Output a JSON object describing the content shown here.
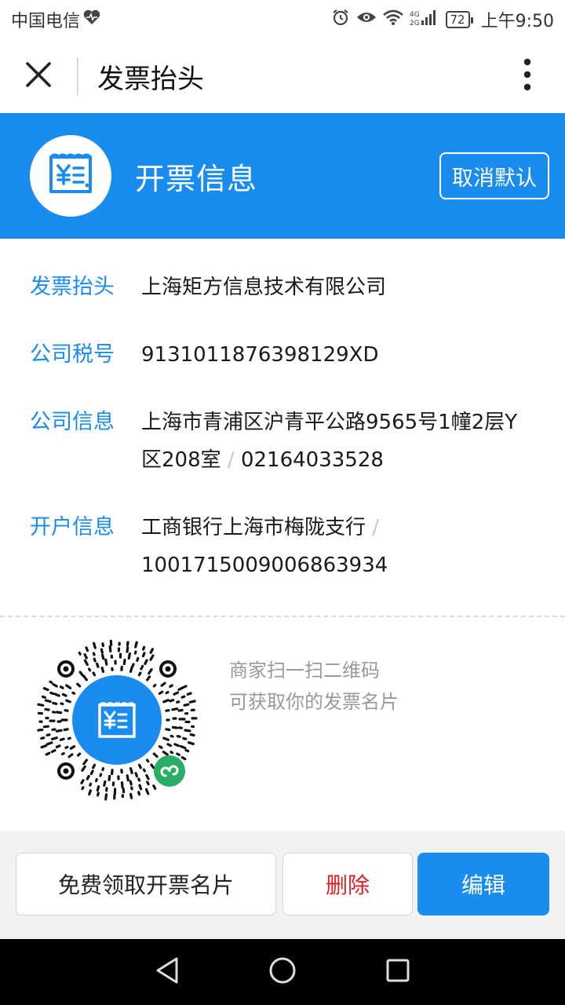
{
  "status_bar": {
    "carrier": "中国电信",
    "battery": "72",
    "time": "上午9:50",
    "network": "4G 2G"
  },
  "header": {
    "title": "发票抬头"
  },
  "banner": {
    "title": "开票信息",
    "cancel_default_label": "取消默认"
  },
  "info": {
    "title_label": "发票抬头",
    "title_value": "上海矩方信息技术有限公司",
    "tax_label": "公司税号",
    "tax_value": "9131011876398129XD",
    "company_label": "公司信息",
    "company_address": "上海市青浦区沪青平公路9565号1幢2层Y区208室",
    "company_phone": "02164033528",
    "bank_label": "开户信息",
    "bank_name": "工商银行上海市梅陇支行",
    "bank_account": "1001715009006863934",
    "separator": "/"
  },
  "qr": {
    "line1": "商家扫一扫二维码",
    "line2": "可获取你的发票名片"
  },
  "actions": {
    "card_label": "免费领取开票名片",
    "delete_label": "删除",
    "edit_label": "编辑"
  },
  "colors": {
    "primary": "#1a8cf0",
    "danger": "#e02020",
    "label": "#1a8cf0"
  },
  "icons": {
    "close": "close-icon",
    "more": "more-vertical-icon",
    "invoice": "invoice-icon",
    "miniprogram": "miniprogram-icon"
  }
}
